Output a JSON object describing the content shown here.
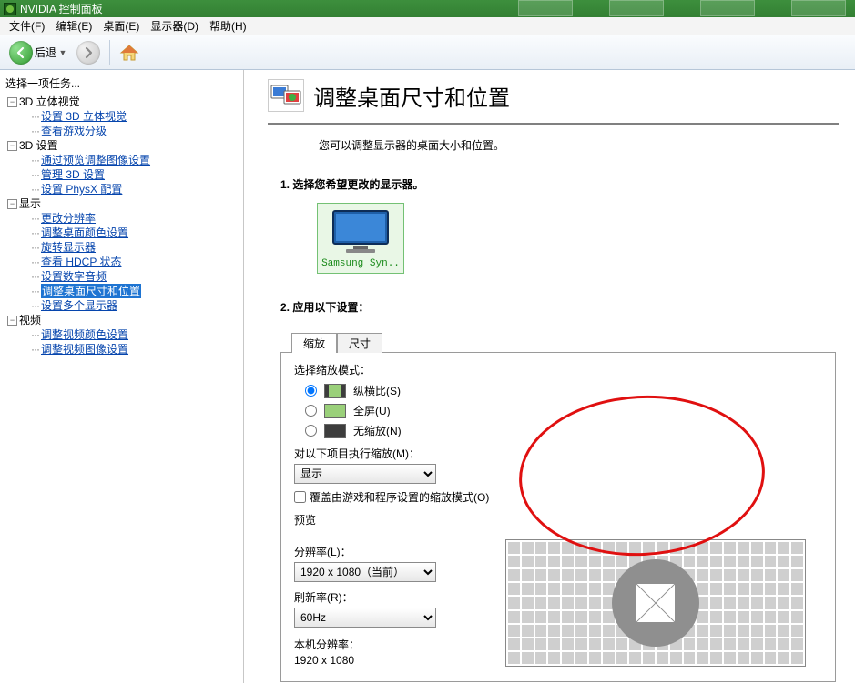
{
  "window": {
    "title": "NVIDIA 控制面板"
  },
  "menu": {
    "file": "文件(F)",
    "edit": "编辑(E)",
    "desktop": "桌面(E)",
    "display": "显示器(D)",
    "help": "帮助(H)"
  },
  "toolbar": {
    "back": "后退"
  },
  "sidebar": {
    "title": "选择一项任务...",
    "g1": {
      "label": "3D 立体视觉",
      "items": [
        "设置 3D 立体视觉",
        "查看游戏分级"
      ]
    },
    "g2": {
      "label": "3D 设置",
      "items": [
        "通过预览调整图像设置",
        "管理 3D 设置",
        "设置 PhysX 配置"
      ]
    },
    "g3": {
      "label": "显示",
      "items": [
        "更改分辨率",
        "调整桌面颜色设置",
        "旋转显示器",
        "查看 HDCP 状态",
        "设置数字音频",
        "调整桌面尺寸和位置",
        "设置多个显示器"
      ],
      "selectedIndex": 5
    },
    "g4": {
      "label": "视频",
      "items": [
        "调整视频颜色设置",
        "调整视频图像设置"
      ]
    }
  },
  "page": {
    "title": "调整桌面尺寸和位置",
    "desc": "您可以调整显示器的桌面大小和位置。",
    "step1_title": "1.   选择您希望更改的显示器。",
    "monitor_label": "Samsung Syn..",
    "step2_title": "2.   应用以下设置：",
    "tabs": {
      "scale": "缩放",
      "size": "尺寸"
    },
    "scale_mode_label": "选择缩放模式：",
    "radios": {
      "aspect": "纵横比(S)",
      "full": "全屏(U)",
      "none": "无缩放(N)"
    },
    "perform_label": "对以下项目执行缩放(M)：",
    "perform_value": "显示",
    "override_label": "覆盖由游戏和程序设置的缩放模式(O)",
    "preview_label": "预览",
    "resolution_label": "分辨率(L)：",
    "resolution_value": "1920 x 1080（当前）",
    "refresh_label": "刷新率(R)：",
    "refresh_value": "60Hz",
    "native_label": "本机分辨率：",
    "native_value": "1920 x 1080"
  }
}
